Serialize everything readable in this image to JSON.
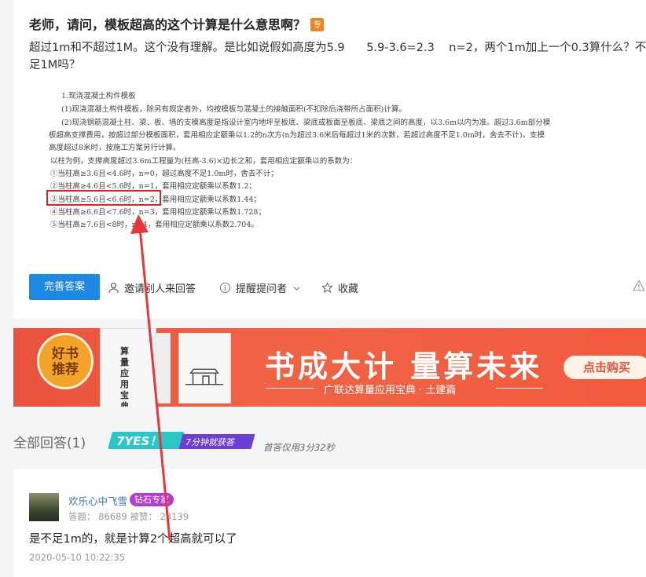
{
  "question": {
    "title": "老师，请问，模板超高的这个计算是什么意思啊？",
    "badge": "专",
    "desc": "超过1m和不超过1M。这个没有理解。是比如说假如高度为5.9      5.9-3.6=2.3    n=2，两个1m加上一个0.3算什么？不足1M吗？",
    "doc_lines": [
      "1.现浇混凝土构件模板",
      "(1)现浇混凝土构件模板，除另有规定者外，均按模板与混凝土的接触面积(不扣除后浇带所占面积)计算。",
      "(2)现浇钢筋混凝土柱、梁、板、墙的支模高度是指设计室内地坪至板底、梁底或板面至板底、梁底之间的高度，以3.6m以内为准。超过3.6m部分模",
      "板超高支撑费用，按超过部分模板面积，套用相应定额乘以1.2的n次方(n为超过3.6米后每超过1米的次数，若超过高度不足1.0m时，舍去不计)。支模",
      "高度超过8米时，按施工方案另行计算。",
      "以柱为例，支撑高度超过3.6m工程量为(柱高-3.6)×边长之和，套用相应定额乘以的系数为：",
      "①当柱高≥3.6且<4.6时，n=0，超过高度不足1.0m时，舍去不计；",
      "②当柱高≥4.6且<5.6时，n=1，套用相应定额乘以系数1.2；",
      "③当柱高≥5.6且<6.6时，n=2，套用相应定额乘以系数1.44；",
      "④当柱高≥6.6且<7.6时，n=3，套用相应定额乘以系数1.728；",
      "⑤当柱高≥7.6且<8时，n=4，套用相应定额乘以系数2.704。"
    ],
    "actions": {
      "improve": "完善答案",
      "invite": "邀请别人来回答",
      "remind": "提醒提问者",
      "collect": "收藏"
    }
  },
  "banner": {
    "badge_line1": "好书",
    "badge_line2": "推荐",
    "book_title": "算量应用宝典",
    "main_text": "书成大计  量算未来",
    "sub_text": "广联达算量应用宝典 · 土建篇",
    "buy": "点击购买"
  },
  "answers_header": {
    "label": "全部回答(1)",
    "yes_text": "7YES！",
    "yes_sub": "7分钟就获答",
    "first_answer": "首答仅用3分32秒"
  },
  "answer": {
    "username": "欢乐心中飞雪",
    "badge": "钻石专家",
    "stats": "答题： 86689     被赞： 23139",
    "text": "是不足1m的，就是计算2个超高就可以了",
    "time": "2020-05-10 10:22:35"
  },
  "colors": {
    "primary": "#1e88e5",
    "banner": "#e9523e",
    "highlight": "#d9252b",
    "diamond": "#b43bd6"
  }
}
